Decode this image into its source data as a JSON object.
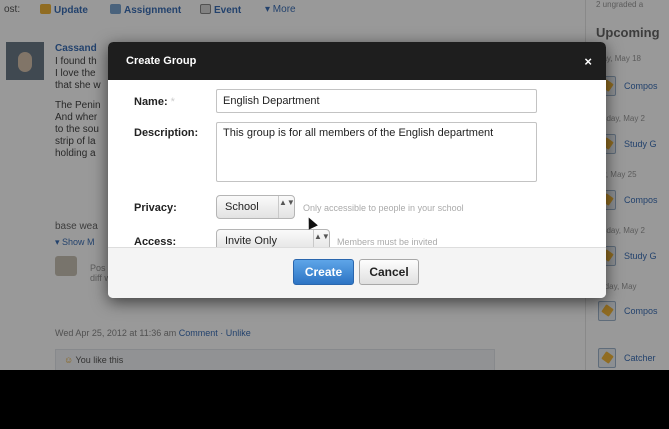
{
  "post_bar": {
    "label": "ost:",
    "update": "Update",
    "assignment": "Assignment",
    "event": "Event",
    "more": "▾ More"
  },
  "post": {
    "author": "Cassand",
    "text_lines_1": [
      "I found th",
      "I love the",
      "that she w"
    ],
    "text_lines_2": [
      "The Penin",
      "And wher",
      "to the sou",
      "strip of la",
      "holding a"
    ],
    "tail": "base wea",
    "show_more": "▾ Show M",
    "attachment_text": "Pos \"I j diff wh",
    "meta_date": "Wed Apr 25, 2012 at 11:36 am",
    "meta_links": "Comment · Unlike",
    "like_text": "You like this"
  },
  "sidebar": {
    "top_text": "2 ungraded a",
    "title": "Upcoming",
    "days": [
      "day, May 18",
      "esday, May 2",
      "ay, May 25",
      "esday, May 2",
      "rsday, May"
    ],
    "events": [
      "Compos",
      "Study G",
      "Compos",
      "Study G",
      "Compos",
      "Catcher"
    ]
  },
  "modal": {
    "title": "Create Group",
    "close": "×",
    "name_label": "Name:",
    "required_mark": "*",
    "name_value": "English Department",
    "description_label": "Description:",
    "description_value": "This group is for all members of the English department",
    "privacy_label": "Privacy:",
    "privacy_value": "School",
    "privacy_hint": "Only accessible to people in your school",
    "access_label": "Access:",
    "access_value": "Invite Only",
    "access_hint": "Members must be invited",
    "select_arrows": "▲▼",
    "create_label": "Create",
    "cancel_label": "Cancel"
  }
}
